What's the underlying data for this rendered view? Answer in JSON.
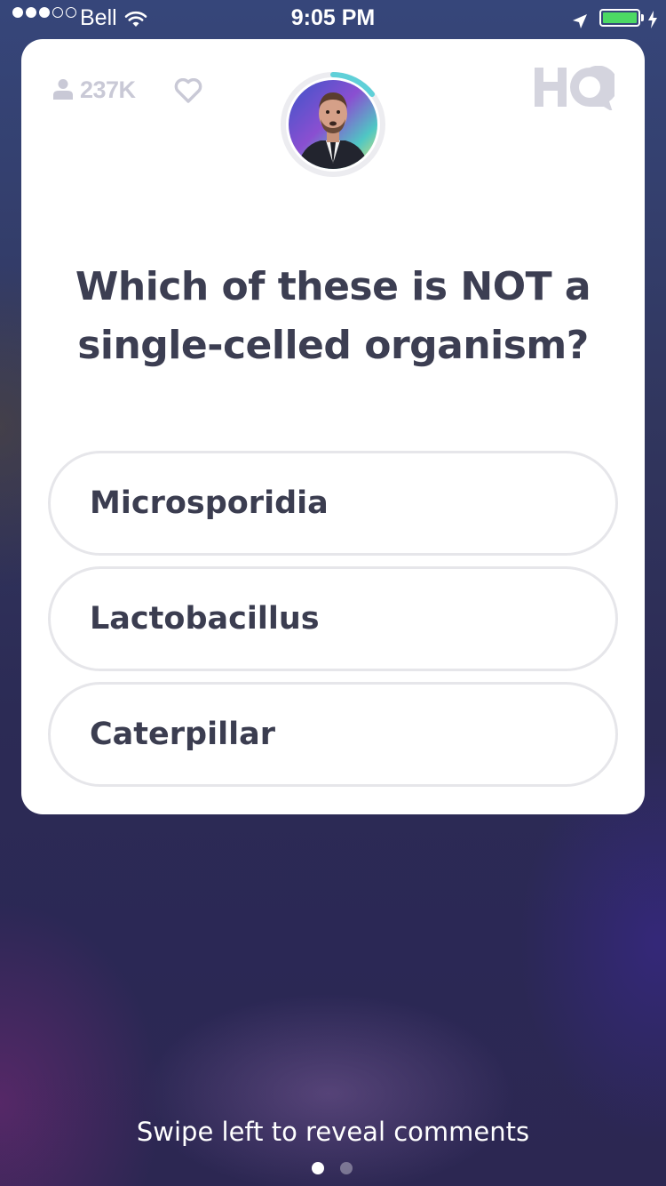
{
  "status_bar": {
    "carrier": "Bell",
    "time": "9:05 PM",
    "signal_bars_filled": 3,
    "signal_bars_total": 5,
    "battery_level": 1.0,
    "battery_color": "#4cd964"
  },
  "card": {
    "viewer_count": "237K",
    "icons": [
      "person-icon",
      "heart-icon",
      "hq-logo"
    ],
    "question": "Which of these is NOT a single-celled organism?",
    "answers": [
      {
        "label": "Microsporidia"
      },
      {
        "label": "Lactobacillus"
      },
      {
        "label": "Caterpillar"
      }
    ],
    "timer_accent": "#5fd0d8"
  },
  "footer": {
    "swipe_hint": "Swipe left to reveal comments",
    "page_index": 1,
    "page_count": 2
  }
}
